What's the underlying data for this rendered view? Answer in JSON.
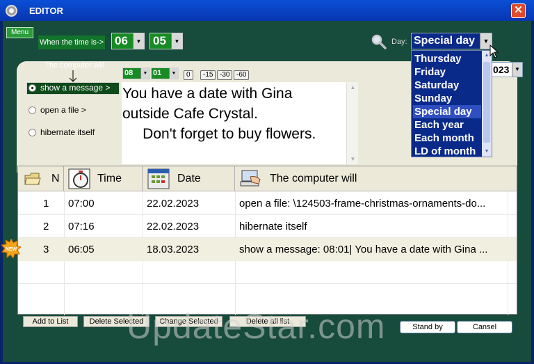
{
  "window": {
    "title": "EDITOR",
    "close_label": "✕"
  },
  "menu": {
    "label": "Menu"
  },
  "when": {
    "label": "When the time is->",
    "hour": "06",
    "minute": "05"
  },
  "day": {
    "label": "Day:",
    "selected": "Special day",
    "options": [
      "Thursday",
      "Friday",
      "Saturday",
      "Sunday",
      "Special day",
      "Each year",
      "Each month",
      "LD of month"
    ]
  },
  "year_value": "023",
  "action": {
    "title": "The computer will",
    "options": [
      "show a message >",
      "open a file >",
      "hibernate itself"
    ],
    "selected_index": 0,
    "time_hour": "08",
    "time_minute": "01",
    "offsets": [
      "0",
      "-15",
      "-30",
      "-60"
    ],
    "message": "You have a date with Gina\noutside Cafe Crystal.\n     Don't forget to buy flowers."
  },
  "table": {
    "headers": {
      "n": "N",
      "time": "Time",
      "date": "Date",
      "action": "The computer will"
    },
    "rows": [
      {
        "n": "1",
        "time": "07:00",
        "date": "22.02.2023",
        "action": "open a file:  \\124503-frame-christmas-ornaments-do..."
      },
      {
        "n": "2",
        "time": "07:16",
        "date": "22.02.2023",
        "action": "hibernate itself"
      },
      {
        "n": "3",
        "time": "06:05",
        "date": "18.03.2023",
        "action": "show a message: 08:01| You have a date with Gina ...",
        "badge": "NEW"
      }
    ]
  },
  "buttons": {
    "add": "Add to List",
    "delete_selected": "Delete Selected",
    "change_selected": "Change Selected",
    "delete_all": "Delete all list",
    "stand_by": "Stand by",
    "cancel": "Cansel"
  },
  "watermark": "UpdateStar.com",
  "colors": {
    "background": "#174b3c",
    "panel": "#ebe9d9",
    "spin_green": "#178b24",
    "dropdown_blue": "#0a2a8a"
  }
}
